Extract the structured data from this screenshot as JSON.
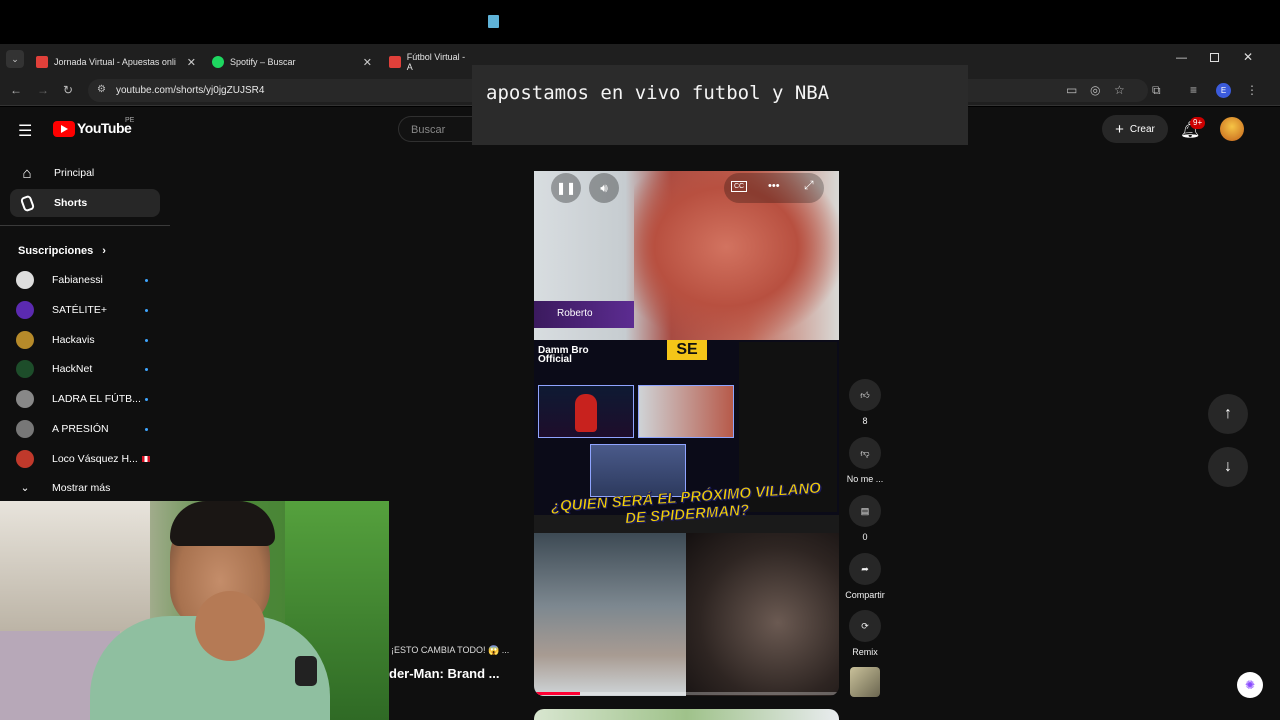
{
  "tabs": [
    {
      "title": "Jornada Virtual - Apuestas onli",
      "color": "#e0403a"
    },
    {
      "title": "Spotify – Buscar",
      "color": "#1ed760"
    },
    {
      "title": "Fútbol Virtual - A",
      "color": "#e0403a"
    }
  ],
  "address": {
    "url": "youtube.com/shorts/yj0jgZUJSR4"
  },
  "overlay": {
    "text": "apostamos en vivo futbol y NBA"
  },
  "youtube": {
    "logo": "YouTube",
    "region": "PE",
    "search_placeholder": "Buscar",
    "create_label": "Crear",
    "notification_count": "9+",
    "account_initial": "E"
  },
  "sidebar": {
    "principal": "Principal",
    "shorts": "Shorts",
    "subscriptions_title": "Suscripciones",
    "subscriptions": [
      {
        "name": "Fabianessi",
        "color": "#ddd"
      },
      {
        "name": "SATÉLITE+",
        "color": "#5b2ab0"
      },
      {
        "name": "Hackavis",
        "color": "#b68a2a"
      },
      {
        "name": "HackNet",
        "color": "#1d4d2a"
      },
      {
        "name": "LADRA EL FÚTB...",
        "color": "#888"
      },
      {
        "name": "A PRESIÓN",
        "color": "#777"
      },
      {
        "name": "Loco Vásquez H...",
        "color": "#c0392b"
      }
    ],
    "show_more": "Mostrar más"
  },
  "short": {
    "speaker_name": "Roberto",
    "channel_logo": "Damm Bro Official",
    "badge": "SE",
    "headline_1": "¿QUIEN SERÁ EL PRÓXIMO VILLANO",
    "headline_2": "DE SPIDERMAN?",
    "progress": 0.15
  },
  "actions": {
    "likes": "8",
    "dislike_label": "No me ...",
    "comments": "0",
    "share_label": "Compartir",
    "remix_label": "Remix"
  },
  "left_preview": {
    "caption_1": "¡ESTO CAMBIA TODO! 😱 ...",
    "caption_2": "der-Man: Brand ..."
  }
}
